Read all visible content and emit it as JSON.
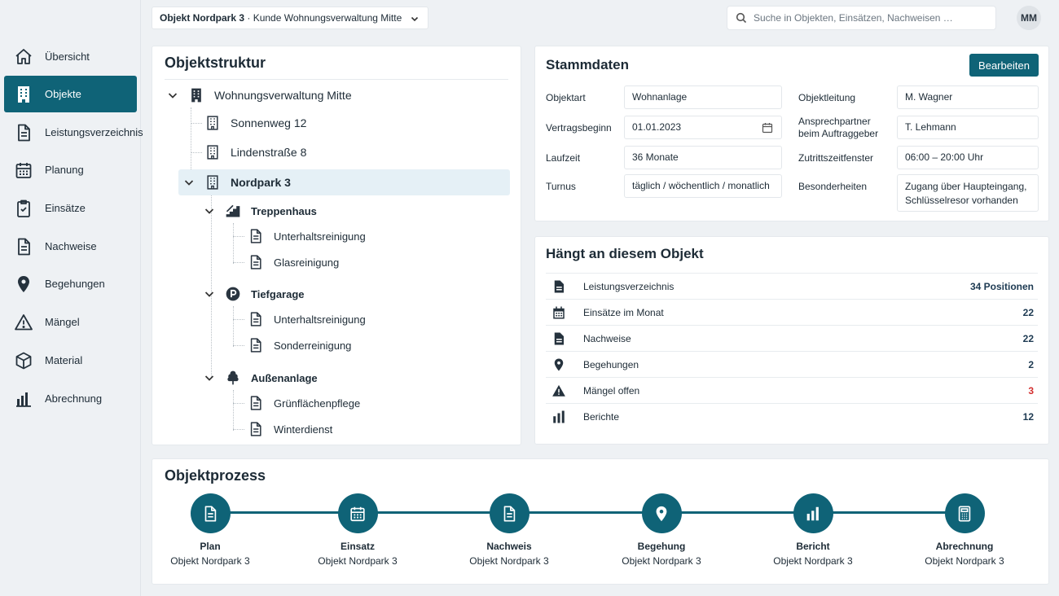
{
  "colors": {
    "accent": "#0f6377",
    "danger": "#d32f2f",
    "selection": "#e5f0f6"
  },
  "sidebar": {
    "items": [
      {
        "label": "Übersicht",
        "icon": "home-icon"
      },
      {
        "label": "Objekte",
        "icon": "building-icon",
        "active": true
      },
      {
        "label": "Leistungsverzeichnis",
        "icon": "document-icon"
      },
      {
        "label": "Planung",
        "icon": "calendar-icon"
      },
      {
        "label": "Einsätze",
        "icon": "clipboard-icon"
      },
      {
        "label": "Nachweise",
        "icon": "document-icon"
      },
      {
        "label": "Begehungen",
        "icon": "location-pin-icon"
      },
      {
        "label": "Mängel",
        "icon": "warning-icon"
      },
      {
        "label": "Material",
        "icon": "box-icon"
      },
      {
        "label": "Abrechnung",
        "icon": "bar-chart-icon"
      }
    ]
  },
  "topbar": {
    "object_select": {
      "strong": "Objekt Nordpark 3",
      "rest": " · Kunde Wohnungsverwaltung Mitte"
    },
    "search_placeholder": "Suche in Objekten, Einsätzen, Nachweisen …",
    "avatar_initials": "MM"
  },
  "tree": {
    "title": "Objektstruktur",
    "root": "Wohnungsverwaltung Mitte",
    "objects": [
      "Sonnenweg 12",
      "Lindenstraße 8",
      "Nordpark 3"
    ],
    "areas": [
      {
        "name": "Treppenhaus",
        "icon": "stairs-icon",
        "services": [
          "Unterhaltsreinigung",
          "Glasreinigung"
        ]
      },
      {
        "name": "Tiefgarage",
        "icon": "parking-icon",
        "services": [
          "Unterhaltsreinigung",
          "Sonderreinigung"
        ]
      },
      {
        "name": "Außenanlage",
        "icon": "tree-icon",
        "services": [
          "Grünflächenpflege",
          "Winterdienst"
        ]
      }
    ]
  },
  "stammdaten": {
    "title": "Stammdaten",
    "edit_label": "Bearbeiten",
    "left": [
      {
        "label": "Objektart",
        "value": "Wohnanlage"
      },
      {
        "label": "Vertragsbeginn",
        "value": "01.01.2023"
      },
      {
        "label": "Laufzeit",
        "value": "36 Monate"
      },
      {
        "label": "Turnus",
        "value": "täglich / wöchentlich / monatlich"
      }
    ],
    "right": [
      {
        "label": "Objektleitung",
        "value": "M. Wagner"
      },
      {
        "label": "Ansprechpartner beim Auftraggeber",
        "value": "T. Lehmann"
      },
      {
        "label": "Zutrittszeitfenster",
        "value": "06:00 – 20:00 Uhr"
      },
      {
        "label": "Besonderheiten",
        "value": "Zugang über Haupteingang, Schlüsselresor vorhanden"
      }
    ]
  },
  "relations": {
    "title": "Hängt an diesem Objekt",
    "rows": [
      {
        "label": "Leistungsverzeichnis",
        "value": "34 Positionen",
        "icon": "document-icon"
      },
      {
        "label": "Einsätze im Monat",
        "value": "22",
        "icon": "calendar-icon"
      },
      {
        "label": "Nachweise",
        "value": "22",
        "icon": "document-icon"
      },
      {
        "label": "Begehungen",
        "value": "2",
        "icon": "location-pin-icon"
      },
      {
        "label": "Mängel offen",
        "value": "3",
        "icon": "warning-icon",
        "alert": true
      },
      {
        "label": "Berichte",
        "value": "12",
        "icon": "bar-chart-icon"
      }
    ]
  },
  "process": {
    "title": "Objektprozess",
    "steps": [
      {
        "title": "Plan",
        "sub": "Objekt Nordpark 3",
        "icon": "document-icon"
      },
      {
        "title": "Einsatz",
        "sub": "Objekt Nordpark 3",
        "icon": "calendar-icon"
      },
      {
        "title": "Nachweis",
        "sub": "Objekt Nordpark 3",
        "icon": "document-icon"
      },
      {
        "title": "Begehung",
        "sub": "Objekt Nordpark 3",
        "icon": "location-pin-icon"
      },
      {
        "title": "Bericht",
        "sub": "Objekt Nordpark 3",
        "icon": "bar-chart-icon"
      },
      {
        "title": "Abrechnung",
        "sub": "Objekt Nordpark 3",
        "icon": "calculator-icon"
      }
    ]
  }
}
